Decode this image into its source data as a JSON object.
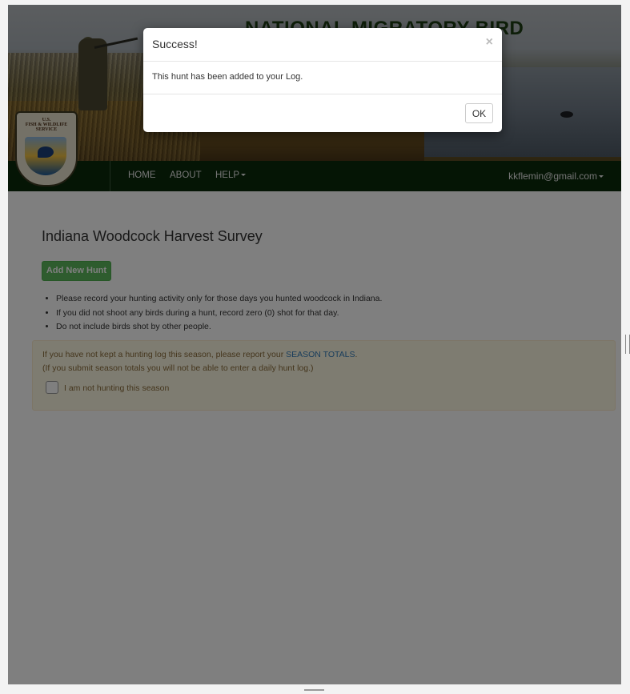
{
  "banner": {
    "title": "NATIONAL MIGRATORY BIRD"
  },
  "logo": {
    "text_line1": "U.S.",
    "text_line2": "FISH & WILDLIFE",
    "text_line3": "SERVICE"
  },
  "nav": {
    "items": [
      "HOME",
      "ABOUT",
      "HELP"
    ],
    "user_email": "kkflemin@gmail.com"
  },
  "main": {
    "title": "Indiana Woodcock Harvest Survey",
    "add_button_label": "Add New Hunt",
    "rules": [
      "Please record your hunting activity only for those days you hunted woodcock in Indiana.",
      "If you did not shoot any birds during a hunt, record zero (0) shot for that day.",
      "Do not include birds shot by other people."
    ]
  },
  "season": {
    "line1_prefix": "If you have not kept a hunting log this season, please report your ",
    "line1_link": "SEASON TOTALS",
    "line1_suffix": ".",
    "line2": "(If you submit season totals you will not be able to enter a daily hunt log.)",
    "checkbox_label": "I am not hunting this season"
  },
  "modal": {
    "title": "Success!",
    "close_symbol": "×",
    "message": "This hunt has been added to your Log.",
    "ok_label": "OK"
  },
  "colors": {
    "nav_bg": "#0b2b0b",
    "success_green": "#5cb85c",
    "warning_bg": "#fcf8e3",
    "link_blue": "#337ab7"
  }
}
